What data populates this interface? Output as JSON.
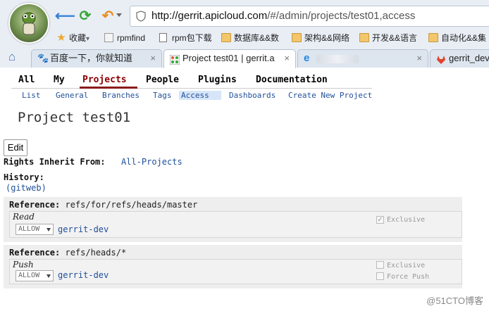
{
  "browser": {
    "url_host": "http://gerrit.apicloud.com",
    "url_rest": "/#/admin/projects/test01,access",
    "bookmarks": [
      {
        "icon": "star-icon",
        "label": "收藏",
        "caret": "▾"
      },
      {
        "icon": "rpmfind-icon",
        "label": "rpmfind"
      },
      {
        "icon": "document-icon",
        "label": "rpm包下载"
      },
      {
        "icon": "folder-icon",
        "label": "数据库&&数"
      },
      {
        "icon": "folder-icon",
        "label": "架构&&网络"
      },
      {
        "icon": "folder-icon",
        "label": "开发&&语言"
      },
      {
        "icon": "folder-icon",
        "label": "自动化&&集"
      }
    ],
    "tabs": [
      {
        "icon": "baidu-icon",
        "label": "百度一下，你就知道",
        "active": false
      },
      {
        "icon": "gerrit-icon",
        "label": "Project test01 | gerrit.a",
        "active": true
      },
      {
        "icon": "ie-icon",
        "label": "",
        "active": false
      },
      {
        "icon": "gitlab-icon",
        "label": "gerrit_dev",
        "active": false
      }
    ],
    "close_glyph": "×"
  },
  "gerrit": {
    "top_menu": [
      "All",
      "My",
      "Projects",
      "People",
      "Plugins",
      "Documentation"
    ],
    "sub_menu": [
      "List",
      "General",
      "Branches",
      "Tags",
      "Access",
      "Dashboards",
      "Create New Project"
    ],
    "selected_top": "Projects",
    "selected_sub": "Access",
    "project_title": "Project test01",
    "edit_label": "Edit",
    "inherit_label": "Rights Inherit From:",
    "inherit_value": "All-Projects",
    "history_label": "History:",
    "history_link": "(gitweb)",
    "references": [
      {
        "label": "Reference:",
        "ref": "refs/for/refs/heads/master",
        "permission": "Read",
        "action": "ALLOW",
        "group": "gerrit-dev",
        "options": [
          {
            "label": "Exclusive",
            "checked": true
          }
        ]
      },
      {
        "label": "Reference:",
        "ref": "refs/heads/*",
        "permission": "Push",
        "action": "ALLOW",
        "group": "gerrit-dev",
        "options": [
          {
            "label": "Exclusive",
            "checked": false
          },
          {
            "label": "Force Push",
            "checked": false
          }
        ]
      }
    ]
  },
  "watermark": "@51CTO博客"
}
